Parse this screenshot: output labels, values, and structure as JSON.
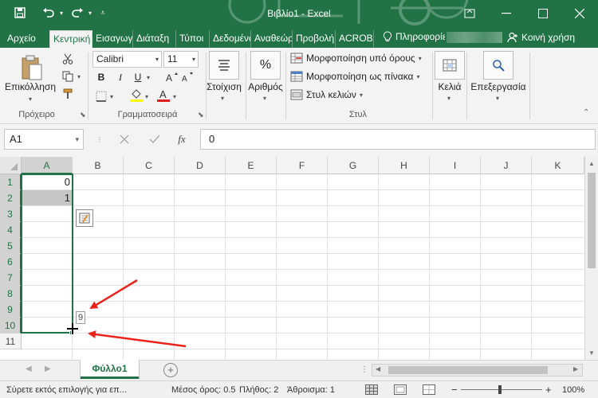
{
  "window": {
    "title": "Βιβλίο1 - Excel"
  },
  "quick_access": {
    "save_icon": "save-icon",
    "undo_icon": "undo-icon",
    "redo_icon": "redo-icon"
  },
  "tabs": [
    {
      "label": "Αρχείο"
    },
    {
      "label": "Κεντρική"
    },
    {
      "label": "Εισαγωγή"
    },
    {
      "label": "Διάταξη"
    },
    {
      "label": "Τύποι"
    },
    {
      "label": "Δεδομένα"
    },
    {
      "label": "Αναθεώρηση"
    },
    {
      "label": "Προβολή"
    },
    {
      "label": "ACROBAT"
    }
  ],
  "tell_me": {
    "label": "Πληροφορίες"
  },
  "share": {
    "label": "Κοινή χρήση"
  },
  "ribbon": {
    "clipboard": {
      "paste_label": "Επικόλληση",
      "group_label": "Πρόχειρο"
    },
    "font": {
      "font_name": "Calibri",
      "font_size": "11",
      "group_label": "Γραμματοσειρά",
      "bold": "B",
      "italic": "I",
      "underline": "U"
    },
    "alignment": {
      "label": "Στοίχιση"
    },
    "number": {
      "label": "Αριθμός",
      "symbol": "%"
    },
    "styles": {
      "conditional": "Μορφοποίηση υπό όρους",
      "as_table": "Μορφοποίηση ως πίνακα",
      "cell_styles": "Στυλ κελιών",
      "group_label": "Στυλ"
    },
    "cells": {
      "label": "Κελιά"
    },
    "editing": {
      "label": "Επεξεργασία"
    }
  },
  "formula_bar": {
    "name_box": "A1",
    "fx": "fx",
    "value": "0"
  },
  "grid": {
    "columns": [
      "A",
      "B",
      "C",
      "D",
      "E",
      "F",
      "G",
      "H",
      "I",
      "J",
      "K"
    ],
    "rows": [
      "1",
      "2",
      "3",
      "4",
      "5",
      "6",
      "7",
      "8",
      "9",
      "10",
      "11"
    ],
    "cells": {
      "A1": "0",
      "A2": "1"
    },
    "fill_tooltip": "9"
  },
  "sheets": [
    {
      "label": "Φύλλο1"
    }
  ],
  "status": {
    "message": "Σύρετε εκτός επιλογής για επ...",
    "average": "Μέσος όρος: 0.5",
    "count": "Πλήθος: 2",
    "sum": "Άθροισμα: 1",
    "zoom": "100%"
  },
  "colors": {
    "accent": "#217346",
    "annotation_arrow": "#e8231b"
  }
}
